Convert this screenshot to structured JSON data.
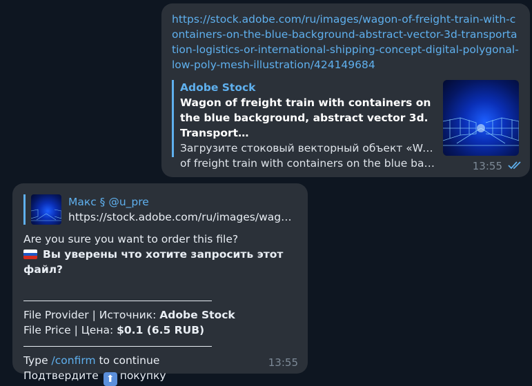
{
  "outgoing": {
    "url": "https://stock.adobe.com/ru/images/wagon-of-freight-train-with-containers-on-the-blue-background-abstract-vector-3d-transportation-logistics-or-international-shipping-concept-digital-polygonal-low-poly-mesh-illustration/424149684",
    "preview": {
      "site": "Adobe Stock",
      "title": "Wagon of freight train with containers on the blue background, abstract vector 3d. Transport…",
      "description_line1": "Загрузите стоковый векторный объект «Wagon",
      "description_line2": "of freight train with containers on the blue back…"
    },
    "time": "13:55"
  },
  "incoming": {
    "reply": {
      "name": "Макс § @u_pre",
      "text": "https://stock.adobe.com/ru/images/wago…"
    },
    "lines": {
      "q_en": "Are you sure you want to order this file?",
      "q_ru": "Вы уверены что хотите запросить этот файл?",
      "provider_label": "File Provider | Источник: ",
      "provider_value": "Adobe Stock",
      "price_label": "File Price | Цена: ",
      "price_value": "$0.1 (6.5 RUB)",
      "type_pre": "Type ",
      "type_cmd": "/confirm",
      "type_post": " to continue",
      "confirm_pre": "Подтвердите ",
      "confirm_icon": "⬆",
      "confirm_post": "покупку"
    },
    "time": "13:55"
  },
  "colors": {
    "accent": "#5fb0ee",
    "bubble": "#2b3139",
    "background": "#0e1621"
  },
  "icons": [
    "double-check-icon",
    "russia-flag-icon",
    "up-arrow-icon"
  ]
}
